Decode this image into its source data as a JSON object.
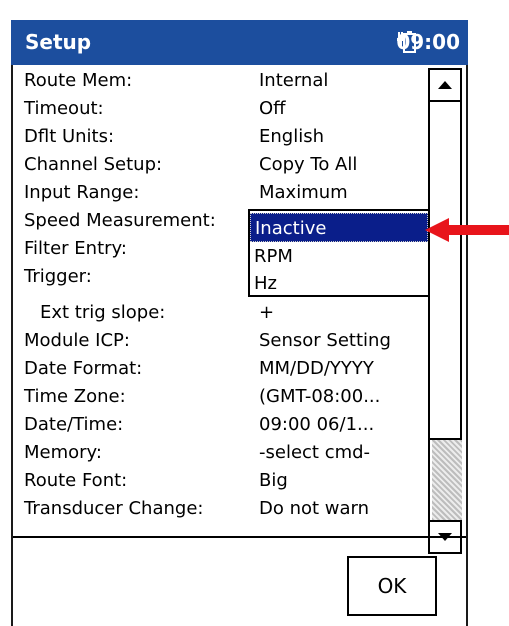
{
  "window": {
    "title": "Setup",
    "time": "09:00"
  },
  "settings": [
    {
      "label": "Route Mem:",
      "value": "Internal"
    },
    {
      "label": "Timeout:",
      "value": "Off"
    },
    {
      "label": "Dflt Units:",
      "value": "English"
    },
    {
      "label": "Channel Setup:",
      "value": "Copy To All"
    },
    {
      "label": "Input Range:",
      "value": "Maximum"
    },
    {
      "label": "Speed Measurement:",
      "value": "Inactive"
    },
    {
      "label": "Filter Entry:",
      "value": ""
    },
    {
      "label": "Trigger:",
      "value": ""
    },
    {
      "label": "Ext trig slope:",
      "value": "+"
    },
    {
      "label": "Module ICP:",
      "value": "Sensor Setting"
    },
    {
      "label": "Date Format:",
      "value": "MM/DD/YYYY"
    },
    {
      "label": "Time Zone:",
      "value": "(GMT-08:00..."
    },
    {
      "label": "Date/Time:",
      "value": "09:00 06/1..."
    },
    {
      "label": "Memory:",
      "value": "-select cmd-"
    },
    {
      "label": "Route Font:",
      "value": "Big"
    },
    {
      "label": "Transducer Change:",
      "value": "Do not warn"
    }
  ],
  "dropdown": {
    "options": [
      "Inactive",
      "RPM",
      "Hz"
    ],
    "selected": "Inactive"
  },
  "buttons": {
    "ok": "OK"
  },
  "colors": {
    "titlebar": "#1c4e9e",
    "selection": "#0a1e8a",
    "arrow": "#e8141b"
  }
}
